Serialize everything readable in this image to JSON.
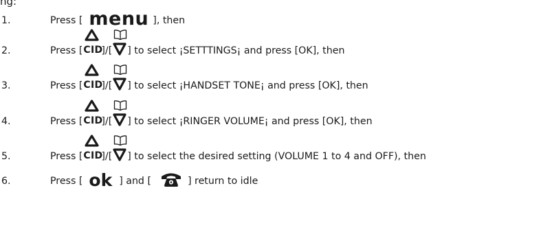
{
  "header_fragment": "ng:",
  "keys": {
    "menu": "menu",
    "ok": "ok",
    "cid": "CID"
  },
  "text": {
    "press_open": "Press [",
    "then_close_menu": "], then",
    "slash": "]/[",
    "ok_and": "] and [",
    "return_idle": "] return to idle"
  },
  "steps": [
    {
      "num": "1."
    },
    {
      "num": "2.",
      "tail": "] to select ¡SETTTINGS¡ and press [OK], then"
    },
    {
      "num": "3.",
      "tail": "] to select ¡HANDSET TONE¡ and press [OK], then"
    },
    {
      "num": "4.",
      "tail": "] to select ¡RINGER VOLUME¡ and press [OK], then"
    },
    {
      "num": "5.",
      "tail": "] to select the desired setting (VOLUME 1 to 4 and OFF), then"
    },
    {
      "num": "6."
    }
  ],
  "icons": {
    "up": "up-triangle-icon",
    "book": "phonebook-icon",
    "down": "down-triangle-icon",
    "phone": "end-call-phone-icon"
  }
}
